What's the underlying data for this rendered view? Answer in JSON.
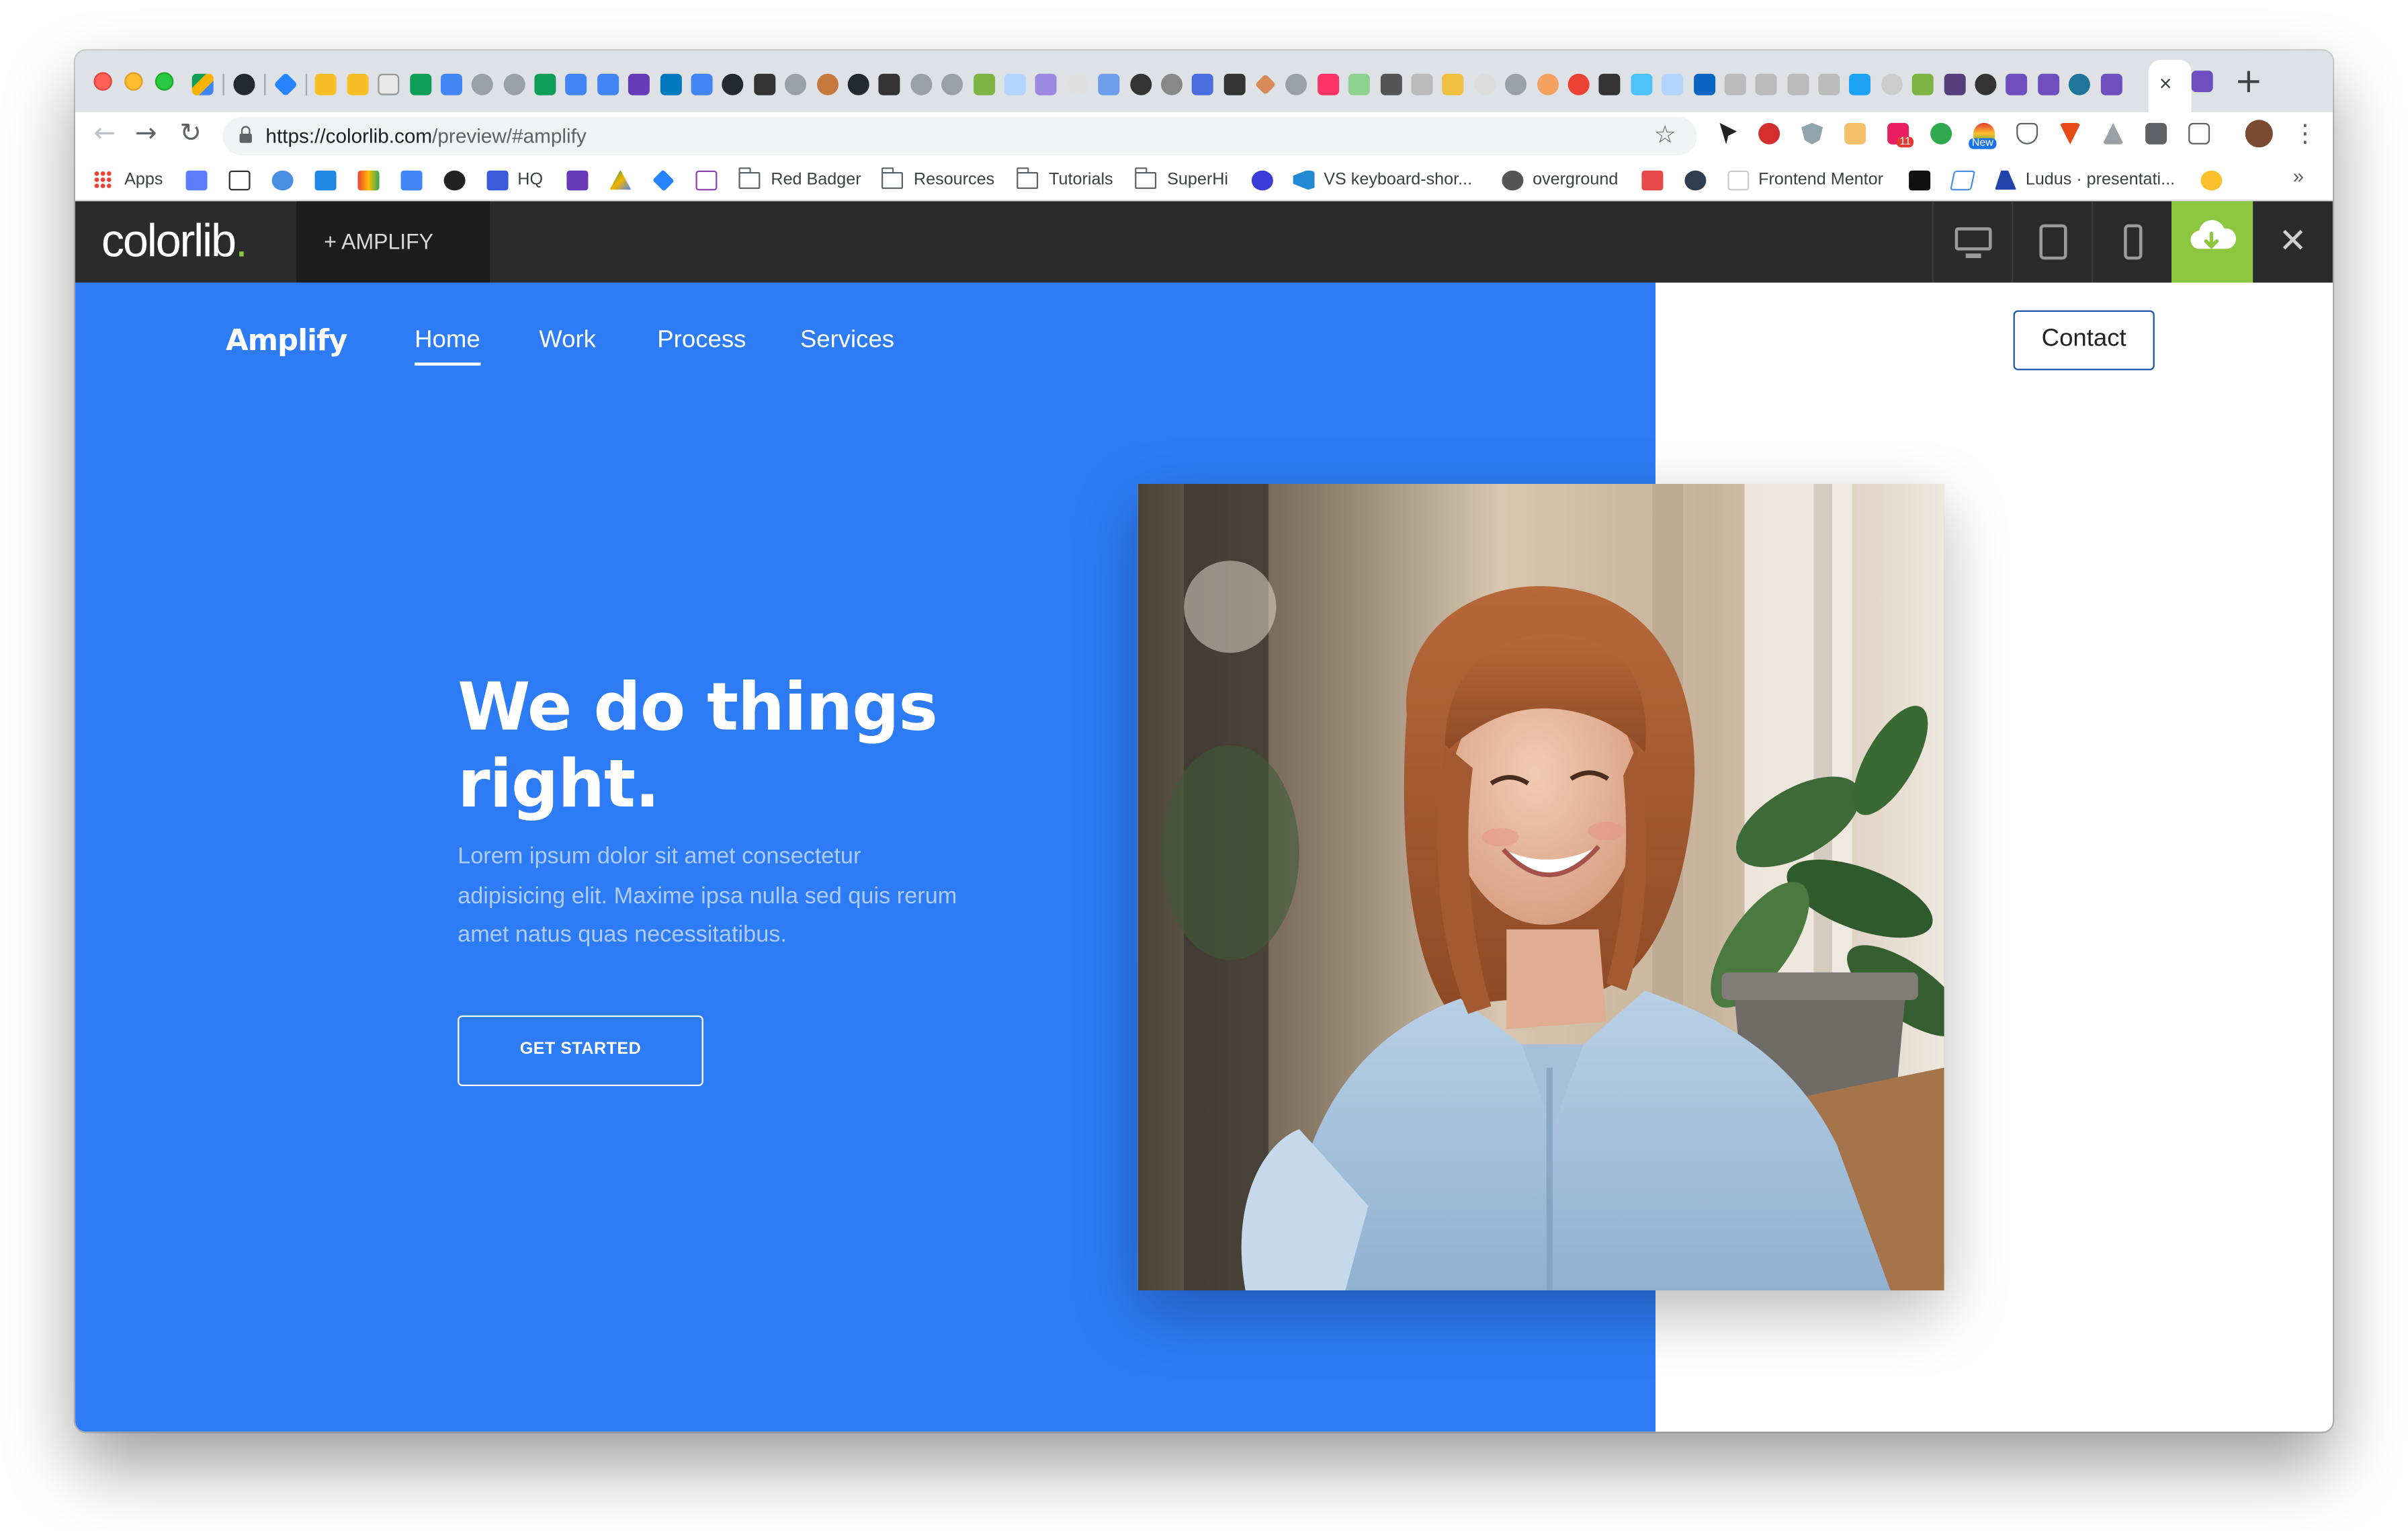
{
  "browser": {
    "tabs": {
      "new_tab": "+",
      "close": "×"
    },
    "address": {
      "domain": "https://colorlib.com",
      "path": "/preview/#amplify"
    },
    "bookmarks": [
      {
        "label": "Apps"
      },
      {
        "label": "HQ"
      },
      {
        "label": "Red Badger"
      },
      {
        "label": "Resources"
      },
      {
        "label": "Tutorials"
      },
      {
        "label": "SuperHi"
      },
      {
        "label": "VS keyboard-shor..."
      },
      {
        "label": "overground"
      },
      {
        "label": "Frontend Mentor"
      },
      {
        "label": "Ludus · presentati..."
      }
    ],
    "overflow": "»",
    "extension_badge_new": "New",
    "extension_badge_count": "11"
  },
  "preview_bar": {
    "logo": "colorlib",
    "logo_dot": ".",
    "theme_label": "+  AMPLIFY",
    "close": "✕"
  },
  "site": {
    "brand": "Amplify",
    "nav": [
      "Home",
      "Work",
      "Process",
      "Services"
    ],
    "contact": "Contact",
    "hero_title": "We do things right.",
    "hero_text": "Lorem ipsum dolor sit amet consectetur adipisicing elit. Maxime ipsa nulla sed quis rerum amet natus quas necessitatibus.",
    "cta": "GET STARTED"
  },
  "colors": {
    "hero_blue": "#2d7cf6",
    "preview_bar": "#2b2b2b",
    "download_green": "#8dc63f",
    "contact_border": "#1e56a8"
  }
}
